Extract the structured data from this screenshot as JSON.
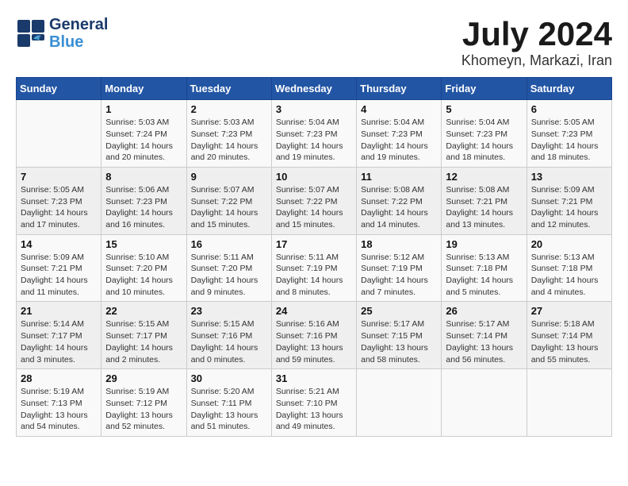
{
  "header": {
    "logo_line1": "General",
    "logo_line2": "Blue",
    "month": "July 2024",
    "location": "Khomeyn, Markazi, Iran"
  },
  "weekdays": [
    "Sunday",
    "Monday",
    "Tuesday",
    "Wednesday",
    "Thursday",
    "Friday",
    "Saturday"
  ],
  "weeks": [
    [
      {
        "day": "",
        "info": ""
      },
      {
        "day": "1",
        "info": "Sunrise: 5:03 AM\nSunset: 7:24 PM\nDaylight: 14 hours\nand 20 minutes."
      },
      {
        "day": "2",
        "info": "Sunrise: 5:03 AM\nSunset: 7:23 PM\nDaylight: 14 hours\nand 20 minutes."
      },
      {
        "day": "3",
        "info": "Sunrise: 5:04 AM\nSunset: 7:23 PM\nDaylight: 14 hours\nand 19 minutes."
      },
      {
        "day": "4",
        "info": "Sunrise: 5:04 AM\nSunset: 7:23 PM\nDaylight: 14 hours\nand 19 minutes."
      },
      {
        "day": "5",
        "info": "Sunrise: 5:04 AM\nSunset: 7:23 PM\nDaylight: 14 hours\nand 18 minutes."
      },
      {
        "day": "6",
        "info": "Sunrise: 5:05 AM\nSunset: 7:23 PM\nDaylight: 14 hours\nand 18 minutes."
      }
    ],
    [
      {
        "day": "7",
        "info": "Sunrise: 5:05 AM\nSunset: 7:23 PM\nDaylight: 14 hours\nand 17 minutes."
      },
      {
        "day": "8",
        "info": "Sunrise: 5:06 AM\nSunset: 7:23 PM\nDaylight: 14 hours\nand 16 minutes."
      },
      {
        "day": "9",
        "info": "Sunrise: 5:07 AM\nSunset: 7:22 PM\nDaylight: 14 hours\nand 15 minutes."
      },
      {
        "day": "10",
        "info": "Sunrise: 5:07 AM\nSunset: 7:22 PM\nDaylight: 14 hours\nand 15 minutes."
      },
      {
        "day": "11",
        "info": "Sunrise: 5:08 AM\nSunset: 7:22 PM\nDaylight: 14 hours\nand 14 minutes."
      },
      {
        "day": "12",
        "info": "Sunrise: 5:08 AM\nSunset: 7:21 PM\nDaylight: 14 hours\nand 13 minutes."
      },
      {
        "day": "13",
        "info": "Sunrise: 5:09 AM\nSunset: 7:21 PM\nDaylight: 14 hours\nand 12 minutes."
      }
    ],
    [
      {
        "day": "14",
        "info": "Sunrise: 5:09 AM\nSunset: 7:21 PM\nDaylight: 14 hours\nand 11 minutes."
      },
      {
        "day": "15",
        "info": "Sunrise: 5:10 AM\nSunset: 7:20 PM\nDaylight: 14 hours\nand 10 minutes."
      },
      {
        "day": "16",
        "info": "Sunrise: 5:11 AM\nSunset: 7:20 PM\nDaylight: 14 hours\nand 9 minutes."
      },
      {
        "day": "17",
        "info": "Sunrise: 5:11 AM\nSunset: 7:19 PM\nDaylight: 14 hours\nand 8 minutes."
      },
      {
        "day": "18",
        "info": "Sunrise: 5:12 AM\nSunset: 7:19 PM\nDaylight: 14 hours\nand 7 minutes."
      },
      {
        "day": "19",
        "info": "Sunrise: 5:13 AM\nSunset: 7:18 PM\nDaylight: 14 hours\nand 5 minutes."
      },
      {
        "day": "20",
        "info": "Sunrise: 5:13 AM\nSunset: 7:18 PM\nDaylight: 14 hours\nand 4 minutes."
      }
    ],
    [
      {
        "day": "21",
        "info": "Sunrise: 5:14 AM\nSunset: 7:17 PM\nDaylight: 14 hours\nand 3 minutes."
      },
      {
        "day": "22",
        "info": "Sunrise: 5:15 AM\nSunset: 7:17 PM\nDaylight: 14 hours\nand 2 minutes."
      },
      {
        "day": "23",
        "info": "Sunrise: 5:15 AM\nSunset: 7:16 PM\nDaylight: 14 hours\nand 0 minutes."
      },
      {
        "day": "24",
        "info": "Sunrise: 5:16 AM\nSunset: 7:16 PM\nDaylight: 13 hours\nand 59 minutes."
      },
      {
        "day": "25",
        "info": "Sunrise: 5:17 AM\nSunset: 7:15 PM\nDaylight: 13 hours\nand 58 minutes."
      },
      {
        "day": "26",
        "info": "Sunrise: 5:17 AM\nSunset: 7:14 PM\nDaylight: 13 hours\nand 56 minutes."
      },
      {
        "day": "27",
        "info": "Sunrise: 5:18 AM\nSunset: 7:14 PM\nDaylight: 13 hours\nand 55 minutes."
      }
    ],
    [
      {
        "day": "28",
        "info": "Sunrise: 5:19 AM\nSunset: 7:13 PM\nDaylight: 13 hours\nand 54 minutes."
      },
      {
        "day": "29",
        "info": "Sunrise: 5:19 AM\nSunset: 7:12 PM\nDaylight: 13 hours\nand 52 minutes."
      },
      {
        "day": "30",
        "info": "Sunrise: 5:20 AM\nSunset: 7:11 PM\nDaylight: 13 hours\nand 51 minutes."
      },
      {
        "day": "31",
        "info": "Sunrise: 5:21 AM\nSunset: 7:10 PM\nDaylight: 13 hours\nand 49 minutes."
      },
      {
        "day": "",
        "info": ""
      },
      {
        "day": "",
        "info": ""
      },
      {
        "day": "",
        "info": ""
      }
    ]
  ]
}
